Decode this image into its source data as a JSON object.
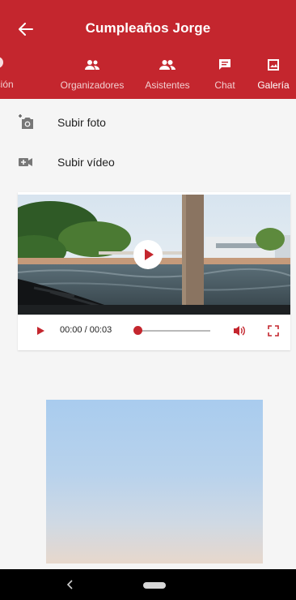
{
  "header": {
    "title": "Cumpleaños Jorge"
  },
  "tabs": [
    {
      "label": "ación",
      "icon": "partial-tab-icon",
      "active": false
    },
    {
      "label": "Organizadores",
      "icon": "group-icon",
      "active": false
    },
    {
      "label": "Asistentes",
      "icon": "people-icon",
      "active": false
    },
    {
      "label": "Chat",
      "icon": "chat-icon",
      "active": false
    },
    {
      "label": "Galería",
      "icon": "gallery-icon",
      "active": true
    }
  ],
  "actions": {
    "upload_photo": "Subir foto",
    "upload_video": "Subir vídeo"
  },
  "video": {
    "time": "00:00 / 00:03",
    "progress": 0
  },
  "colors": {
    "primary": "#c4262e",
    "background": "#f5f5f5"
  }
}
